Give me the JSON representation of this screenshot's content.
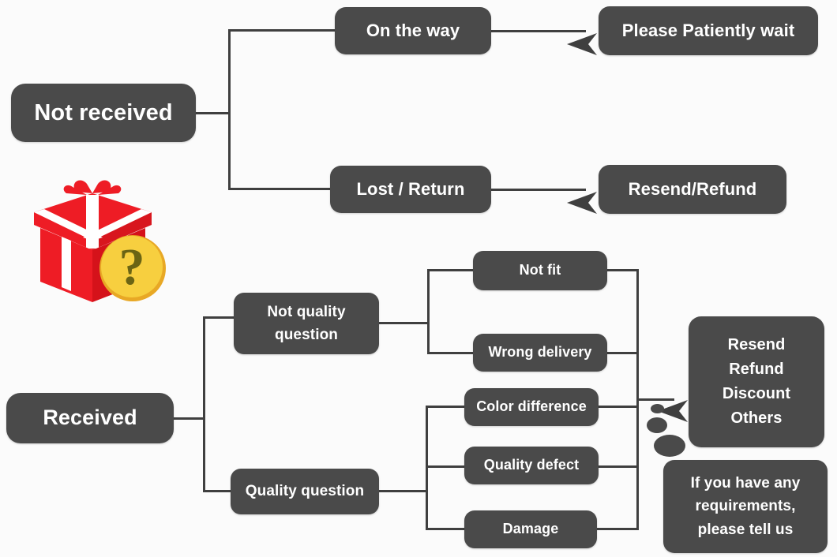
{
  "diagram": {
    "title": "Order status handling flowchart",
    "colors": {
      "node_fill": "#4a4a4a",
      "node_text": "#ffffff",
      "connector": "#3f3f3f",
      "background": "#fbfbfb",
      "gift_red": "#ee1c25",
      "gift_ribbon": "#ffffff",
      "badge_yellow": "#f7cf3f",
      "badge_mark": "#6b6414"
    },
    "icon": {
      "name": "gift-box-question-icon",
      "description": "Red gift box with white ribbon and a yellow circle containing a question mark"
    },
    "nodes": {
      "not_received": "Not received",
      "on_the_way": "On the way",
      "please_wait": "Please Patiently wait",
      "lost_return": "Lost / Return",
      "resend_refund": "Resend/Refund",
      "received": "Received",
      "not_quality_question_line1": "Not quality",
      "not_quality_question_line2": "question",
      "quality_question": "Quality question",
      "not_fit": "Not fit",
      "wrong_delivery": "Wrong delivery",
      "color_difference": "Color difference",
      "quality_defect": "Quality defect",
      "damage": "Damage",
      "outcome_line1": "Resend",
      "outcome_line2": "Refund",
      "outcome_line3": "Discount",
      "outcome_line4": "Others",
      "note_line1": "If you have any",
      "note_line2": "requirements,",
      "note_line3": "please tell us"
    }
  }
}
